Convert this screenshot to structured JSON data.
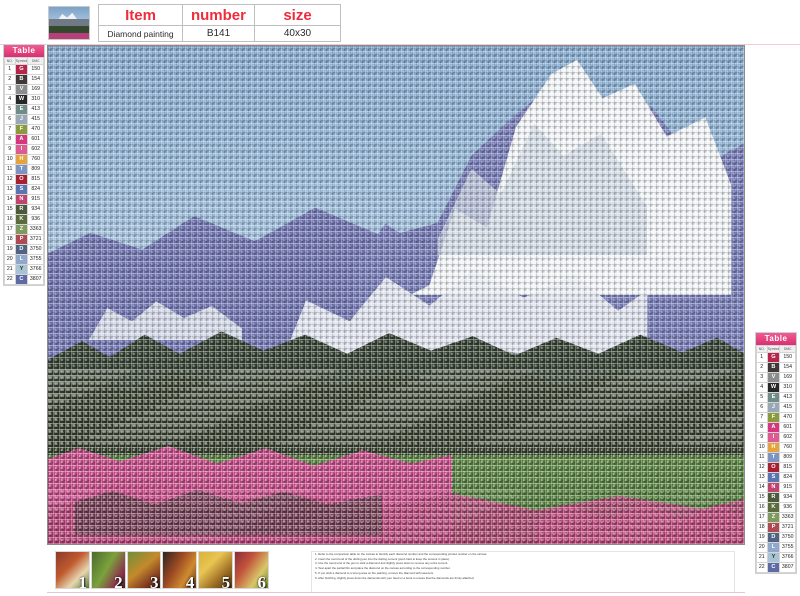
{
  "header": {
    "thumbnail_name": "mountain-meadow-photo",
    "columns": [
      "Item",
      "number",
      "size"
    ],
    "row": {
      "item": "Diamond painting",
      "number": "B141",
      "size": "40x30"
    }
  },
  "color_table": {
    "title": "Table",
    "columns": [
      "NO.",
      "Symbol",
      "DMC"
    ],
    "rows": [
      {
        "no": "1",
        "symbol": "G",
        "dmc": "150",
        "color": "#b8254b",
        "text_color": "#ffffff"
      },
      {
        "no": "2",
        "symbol": "B",
        "dmc": "154",
        "color": "#3f3a38",
        "text_color": "#ffffff"
      },
      {
        "no": "3",
        "symbol": "V",
        "dmc": "169",
        "color": "#8b8d8c",
        "text_color": "#ffffff"
      },
      {
        "no": "4",
        "symbol": "W",
        "dmc": "310",
        "color": "#272727",
        "text_color": "#ffffff"
      },
      {
        "no": "5",
        "symbol": "E",
        "dmc": "413",
        "color": "#6f8c86",
        "text_color": "#ffffff"
      },
      {
        "no": "6",
        "symbol": "J",
        "dmc": "415",
        "color": "#9aa7b4",
        "text_color": "#ffffff"
      },
      {
        "no": "7",
        "symbol": "F",
        "dmc": "470",
        "color": "#8a9a3c",
        "text_color": "#ffffff"
      },
      {
        "no": "8",
        "symbol": "A",
        "dmc": "601",
        "color": "#d4377f",
        "text_color": "#ffffff"
      },
      {
        "no": "9",
        "symbol": "I",
        "dmc": "602",
        "color": "#e05a92",
        "text_color": "#ffffff"
      },
      {
        "no": "10",
        "symbol": "H",
        "dmc": "760",
        "color": "#e8a23c",
        "text_color": "#ffffff"
      },
      {
        "no": "11",
        "symbol": "T",
        "dmc": "809",
        "color": "#7d93c4",
        "text_color": "#ffffff"
      },
      {
        "no": "12",
        "symbol": "O",
        "dmc": "815",
        "color": "#a82032",
        "text_color": "#ffffff"
      },
      {
        "no": "13",
        "symbol": "S",
        "dmc": "824",
        "color": "#5b74b4",
        "text_color": "#ffffff"
      },
      {
        "no": "14",
        "symbol": "N",
        "dmc": "915",
        "color": "#c0436e",
        "text_color": "#ffffff"
      },
      {
        "no": "15",
        "symbol": "R",
        "dmc": "934",
        "color": "#4a5a3a",
        "text_color": "#ffffff"
      },
      {
        "no": "16",
        "symbol": "K",
        "dmc": "936",
        "color": "#5c6b3c",
        "text_color": "#ffffff"
      },
      {
        "no": "17",
        "symbol": "Z",
        "dmc": "3363",
        "color": "#7e9a5c",
        "text_color": "#ffffff"
      },
      {
        "no": "18",
        "symbol": "P",
        "dmc": "3721",
        "color": "#b04a52",
        "text_color": "#ffffff"
      },
      {
        "no": "19",
        "symbol": "D",
        "dmc": "3750",
        "color": "#4f6383",
        "text_color": "#ffffff"
      },
      {
        "no": "20",
        "symbol": "L",
        "dmc": "3755",
        "color": "#8fa8cc",
        "text_color": "#ffffff"
      },
      {
        "no": "21",
        "symbol": "Y",
        "dmc": "3766",
        "color": "#a8c4d4",
        "text_color": "#333333"
      },
      {
        "no": "22",
        "symbol": "C",
        "dmc": "3807",
        "color": "#5d6aa6",
        "text_color": "#ffffff"
      }
    ]
  },
  "canvas": {
    "name": "diamond-painting-preview",
    "description": "Snow-capped mountain with dark conifer forest, green meadow and pink wildflower field rendered as a symbol grid"
  },
  "bottom": {
    "steps": [
      {
        "num": "1",
        "name": "step-thumbnail-1"
      },
      {
        "num": "2",
        "name": "step-thumbnail-2"
      },
      {
        "num": "3",
        "name": "step-thumbnail-3"
      },
      {
        "num": "4",
        "name": "step-thumbnail-4"
      },
      {
        "num": "5",
        "name": "step-thumbnail-5"
      },
      {
        "num": "6",
        "name": "step-thumbnail-6"
      }
    ],
    "instructions": [
      "1. Refer to the comparison table on the canvas to identify each diamond number and the corresponding printed number on the canvas.",
      "2. Insert the round end of the dotting pen into the dotting cement (push hard to keep the cement in place).",
      "3. Use the round end of the pen to stick a diamond and slightly press down to remove any extra cement.",
      "4. Tear apart the partial film and place the diamond on the canvas according to the corresponding number.",
      "5. If you stick a diamond to a wrong area on the painting, remove the diamond with tweezers.",
      "6. After finishing, slightly press down the diamonds with your hand or a book to ensure that the diamonds are firmly attached."
    ]
  }
}
